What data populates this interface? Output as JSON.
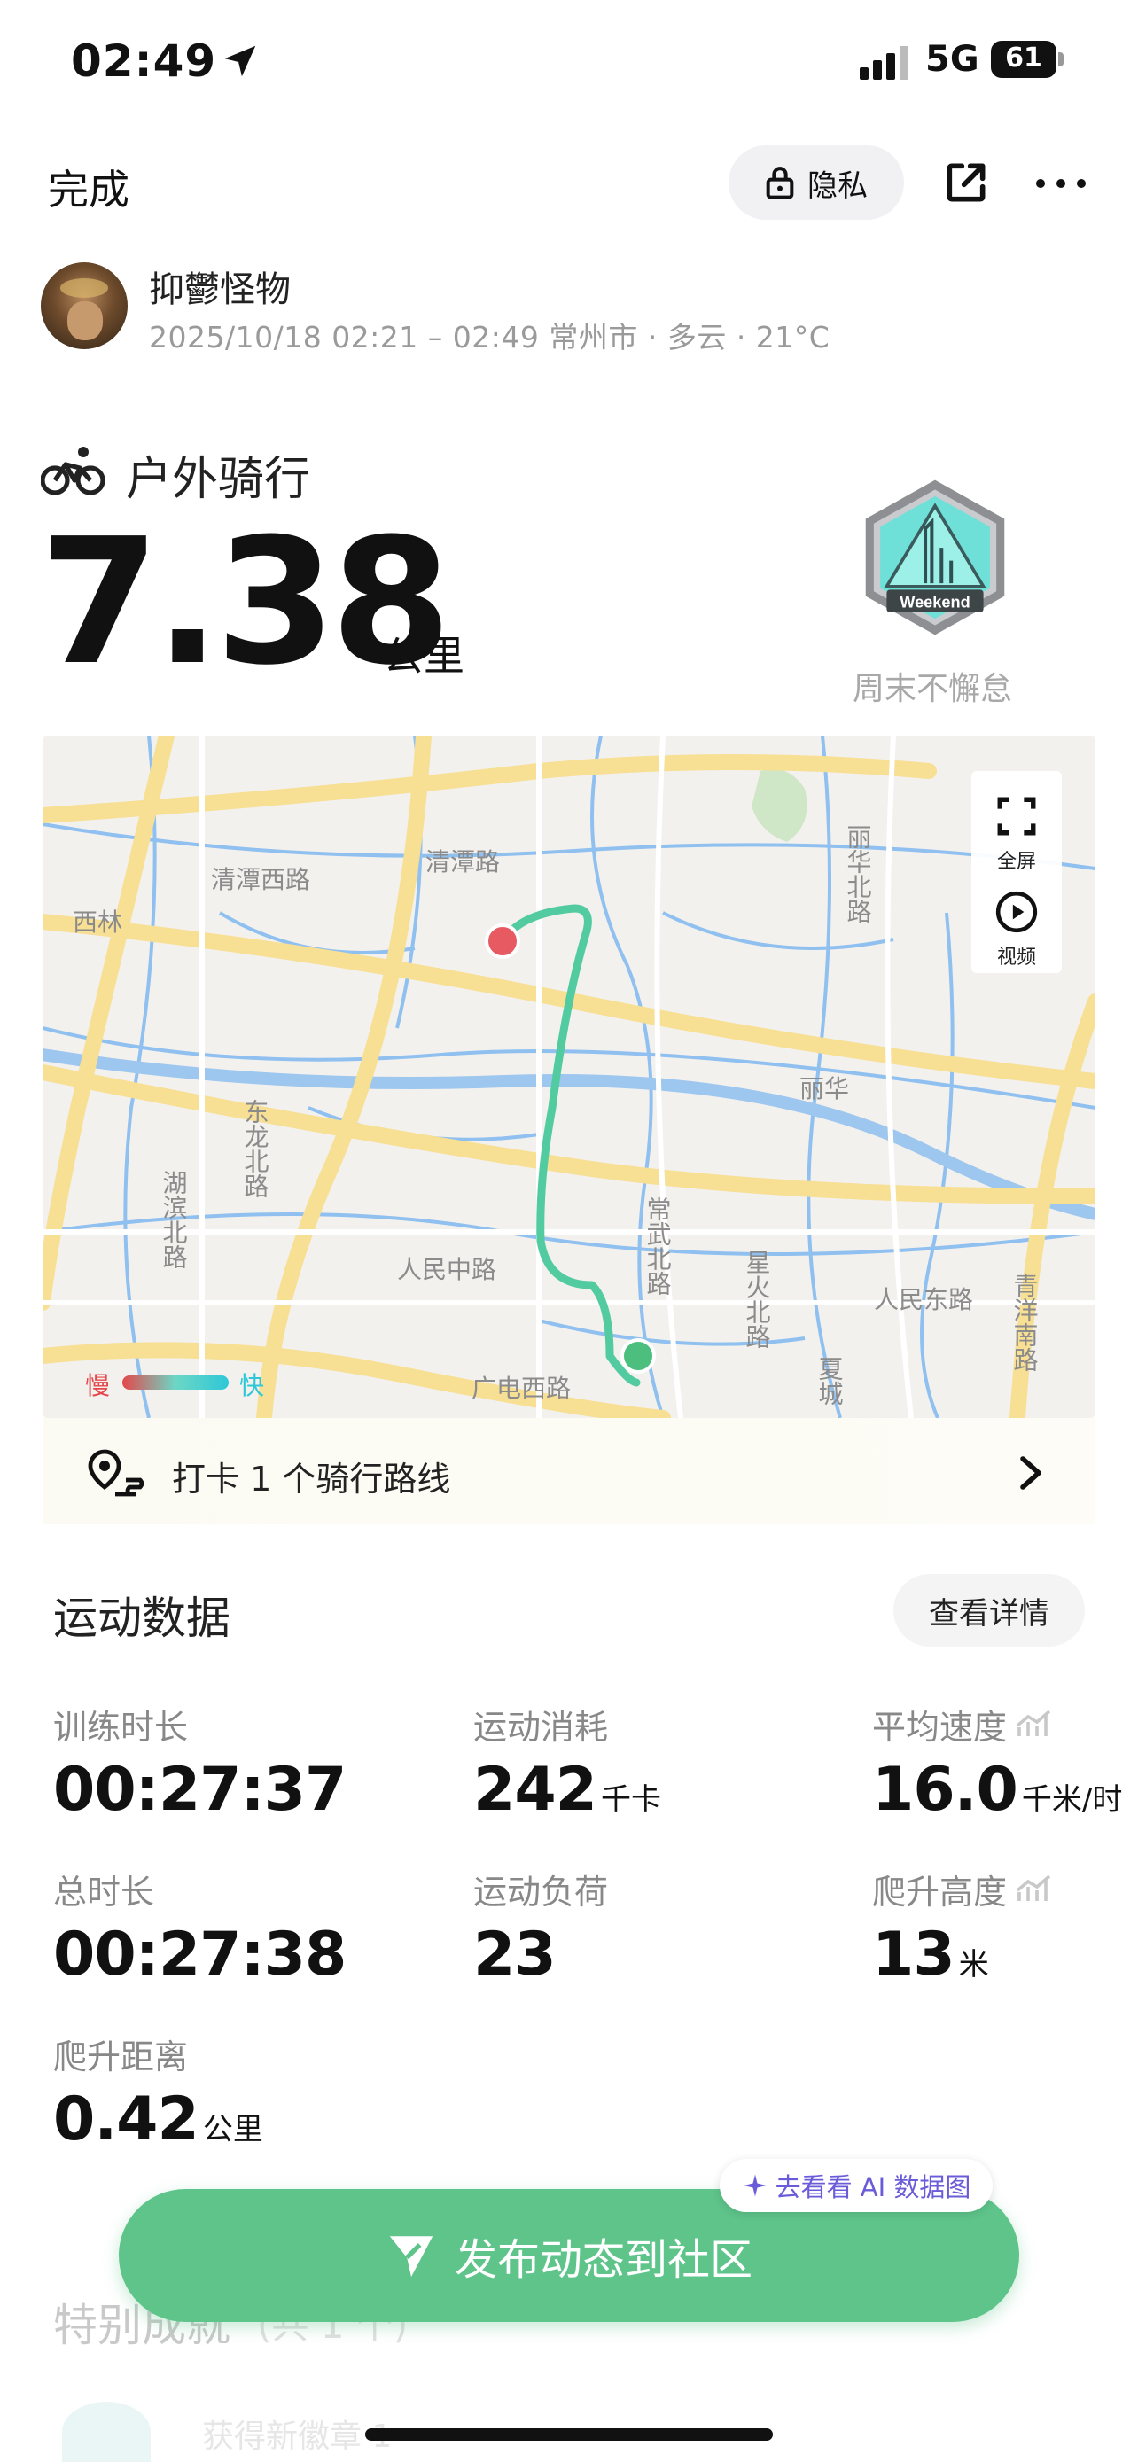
{
  "status_bar": {
    "time": "02:49",
    "network": "5G",
    "battery": "61"
  },
  "header": {
    "done_label": "完成",
    "privacy_label": "隐私"
  },
  "user": {
    "name": "抑鬱怪物",
    "meta": "2025/10/18 02:21 – 02:49 常州市 · 多云 · 21°C"
  },
  "activity": {
    "type": "户外骑行",
    "distance": "7.38",
    "distance_unit": "公里",
    "badge_text": "Weekend",
    "badge_label": "周末不懈怠"
  },
  "map": {
    "labels": {
      "qingtan_west": "清潭西路",
      "qingtan": "清潭路",
      "xilin": "西林",
      "lihua": "丽华",
      "lihua_north": "丽华北路",
      "donglong_north": "东龙北路",
      "hubin_north": "湖滨北路",
      "renmin_mid": "人民中路",
      "changwu_north": "常武北路",
      "xinghuo_north": "星火北路",
      "renmin_east": "人民东路",
      "qingyang_south": "青洋南路",
      "guangdian_west": "广电西路",
      "xiacheng": "夏城"
    },
    "fullscreen_label": "全屏",
    "video_label": "视频",
    "legend_slow": "慢",
    "legend_fast": "快"
  },
  "checkin": {
    "text": "打卡 1 个骑行路线"
  },
  "stats": {
    "title": "运动数据",
    "detail_button": "查看详情",
    "items": [
      {
        "label": "训练时长",
        "value": "00:27:37",
        "unit": ""
      },
      {
        "label": "运动消耗",
        "value": "242",
        "unit": "千卡"
      },
      {
        "label": "平均速度",
        "value": "16.0",
        "unit": "千米/时"
      },
      {
        "label": "总时长",
        "value": "00:27:38",
        "unit": ""
      },
      {
        "label": "运动负荷",
        "value": "23",
        "unit": ""
      },
      {
        "label": "爬升高度",
        "value": "13",
        "unit": "米"
      },
      {
        "label": "爬升距离",
        "value": "0.42",
        "unit": "公里"
      }
    ]
  },
  "ai_pill": {
    "label": "去看看 AI 数据图"
  },
  "publish_button": {
    "label": "发布动态到社区"
  },
  "achievement": {
    "title": "特别成就",
    "count": "(共 1 个)",
    "sub": "获得新徽章 1"
  },
  "colors": {
    "accent_green": "#5ec48a",
    "route": "#52cba0",
    "start": "#e85a62",
    "end": "#4cbf7f"
  }
}
